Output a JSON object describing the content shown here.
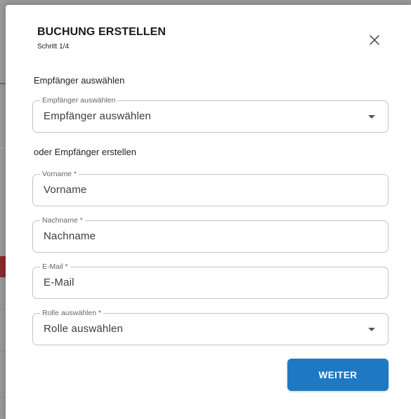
{
  "dialog": {
    "title": "BUCHUNG ERSTELLEN",
    "step": "Schritt 1/4",
    "close_icon": "close-icon"
  },
  "recipient_select": {
    "section_label": "Empfänger auswählen",
    "legend": "Empfänger auswählen",
    "value": "Empfänger auswählen",
    "icon": "chevron-down-icon"
  },
  "create_recipient": {
    "section_label": "oder Empfänger erstellen",
    "first_name": {
      "legend": "Vorname *",
      "placeholder": "Vorname"
    },
    "last_name": {
      "legend": "Nachname *",
      "placeholder": "Nachname"
    },
    "email": {
      "legend": "E-Mail *",
      "placeholder": "E-Mail"
    },
    "role": {
      "legend": "Rolle auswählen *",
      "value": "Rolle auswählen",
      "icon": "chevron-down-icon"
    }
  },
  "actions": {
    "next_label": "WEITER"
  },
  "colors": {
    "primary": "#1f78c4",
    "border": "#c4c4c4",
    "backdrop": "#9a9a9a"
  }
}
